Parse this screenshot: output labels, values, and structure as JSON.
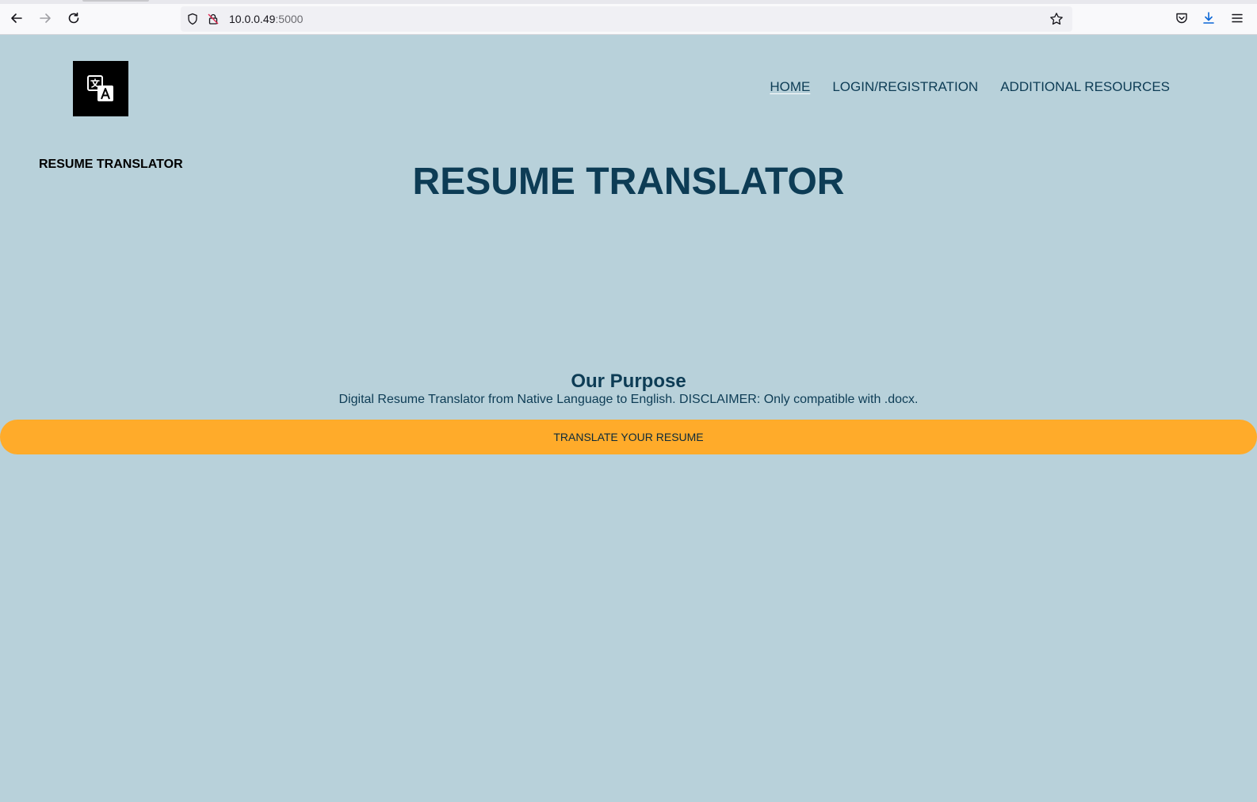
{
  "browser": {
    "url_host": "10.0.0.49",
    "url_port": ":5000"
  },
  "header": {
    "logo_icon": "translate-icon",
    "nav": [
      {
        "label": "HOME"
      },
      {
        "label": "LOGIN/REGISTRATION"
      },
      {
        "label": "ADDITIONAL RESOURCES"
      }
    ]
  },
  "brand": {
    "text": "RESUME TRANSLATOR"
  },
  "hero": {
    "title": "RESUME TRANSLATOR"
  },
  "purpose": {
    "title": "Our Purpose",
    "description": "Digital Resume Translator from Native Language to English. DISCLAIMER: Only compatible with .docx."
  },
  "cta": {
    "label": "TRANSLATE YOUR RESUME",
    "color": "#ffab2a"
  },
  "colors": {
    "page_background": "#b8d1da",
    "heading": "#0d3c55"
  }
}
